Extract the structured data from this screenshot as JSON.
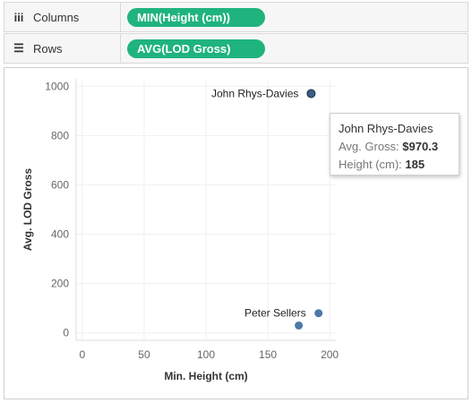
{
  "shelves": {
    "columns": {
      "label": "Columns",
      "icon": "columns-icon",
      "pill": "MIN(Height (cm))"
    },
    "rows": {
      "label": "Rows",
      "icon": "rows-icon",
      "pill": "AVG(LOD Gross)"
    }
  },
  "colors": {
    "pill": "#1fb37e",
    "mark": "#4e79a7",
    "mark_highlight": "#3b5f86"
  },
  "chart_data": {
    "type": "scatter",
    "xlabel": "Min. Height (cm)",
    "ylabel": "Avg. LOD Gross",
    "xlim": [
      -5,
      205
    ],
    "ylim": [
      -30,
      1030
    ],
    "x_ticks": [
      0,
      50,
      100,
      150,
      200
    ],
    "y_ticks": [
      0,
      200,
      400,
      600,
      800,
      1000
    ],
    "grid": true,
    "points": [
      {
        "label": "John Rhys-Davies",
        "x": 185,
        "y": 970.3,
        "highlighted": true
      },
      {
        "label": "Peter Sellers",
        "x": 191,
        "y": 80
      },
      {
        "label": "",
        "x": 175,
        "y": 30
      }
    ]
  },
  "tooltip": {
    "title": "John Rhys-Davies",
    "gross_label": "Avg. Gross: ",
    "gross_value": "$970.3",
    "height_label": "Height (cm): ",
    "height_value": "185"
  }
}
